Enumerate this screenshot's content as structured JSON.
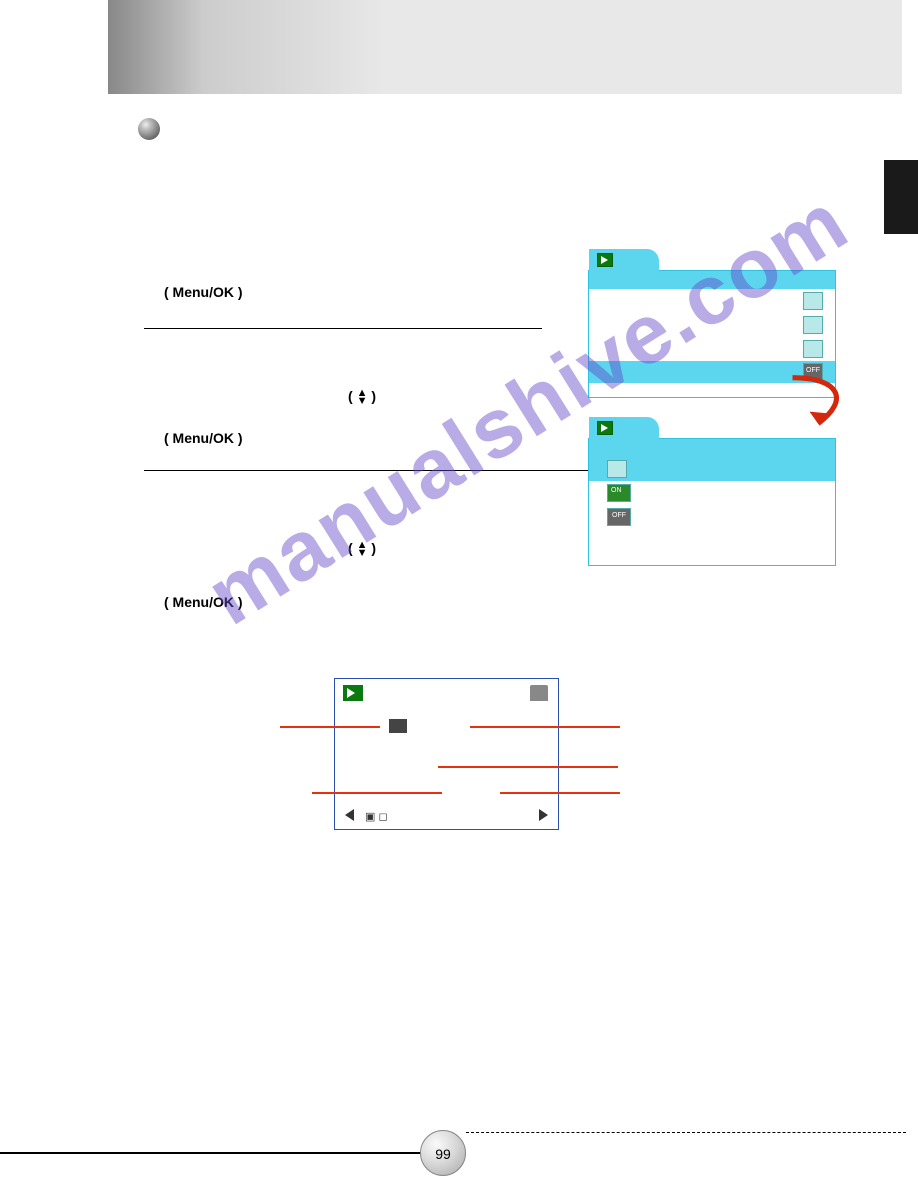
{
  "labels": {
    "menu_ok_1": "( Menu/OK )",
    "menu_ok_2": "( Menu/OK )",
    "menu_ok_3": "( Menu/OK )"
  },
  "panel1": {
    "off_label": "OFF"
  },
  "panel2": {
    "on_label": "ON",
    "off_label": "OFF"
  },
  "page_number": "99",
  "watermark": "manualshive.com"
}
